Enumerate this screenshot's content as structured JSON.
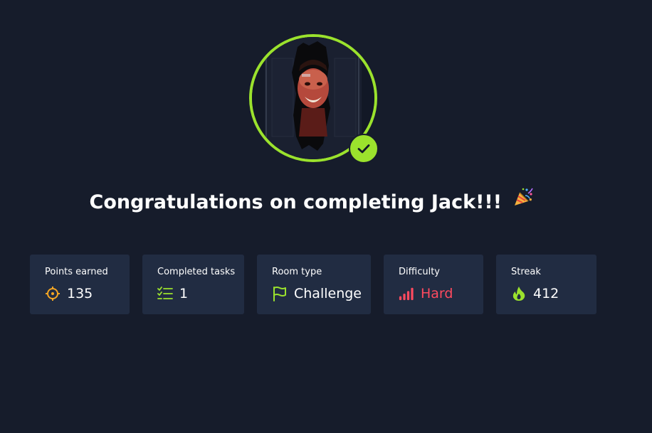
{
  "headline": {
    "text": "Congratulations on completing Jack!!!",
    "emoji_icon": "party-popper-icon"
  },
  "avatar": {
    "ring_color": "#9be22d",
    "badge_icon": "check-icon"
  },
  "stats": [
    {
      "label": "Points earned",
      "value": "135",
      "icon": "target-icon",
      "icon_color": "#f5a623"
    },
    {
      "label": "Completed tasks",
      "value": "1",
      "icon": "checklist-icon",
      "icon_color": "#9be22d"
    },
    {
      "label": "Room type",
      "value": "Challenge",
      "icon": "flag-icon",
      "icon_color": "#9be22d"
    },
    {
      "label": "Difficulty",
      "value": "Hard",
      "icon": "signal-bars-icon",
      "icon_color": "#ff4a5f",
      "value_color": "#ff4a5f"
    },
    {
      "label": "Streak",
      "value": "412",
      "icon": "flame-icon",
      "icon_color": "#9be22d"
    }
  ],
  "colors": {
    "background": "#161c2b",
    "card": "#212c42",
    "accent": "#9be22d"
  }
}
